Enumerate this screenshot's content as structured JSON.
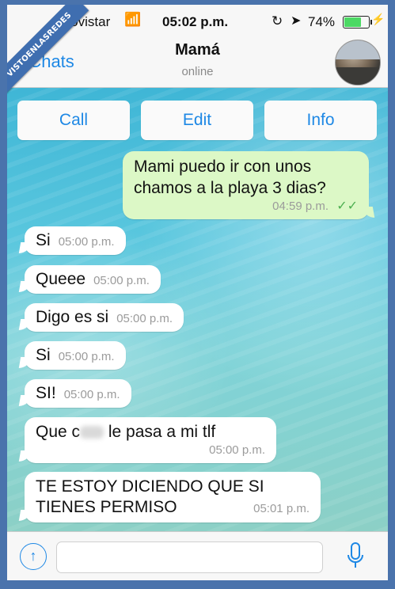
{
  "watermark": "VISTOENLASREDES",
  "status_bar": {
    "carrier": "movistar",
    "time": "05:02 p.m.",
    "battery_pct": "74%",
    "battery_level": 0.74
  },
  "nav": {
    "back_label": "Chats",
    "title": "Mamá",
    "subtitle": "online"
  },
  "actions": {
    "call": "Call",
    "edit": "Edit",
    "info": "Info"
  },
  "messages": [
    {
      "dir": "out",
      "line1": "Mami puedo ir con unos",
      "line2": "chamos a la playa 3 dias?",
      "time": "04:59 p.m."
    },
    {
      "dir": "in",
      "text": "Si",
      "time": "05:00 p.m."
    },
    {
      "dir": "in",
      "text": "Queee",
      "time": "05:00 p.m."
    },
    {
      "dir": "in",
      "text": "Digo es si",
      "time": "05:00 p.m."
    },
    {
      "dir": "in",
      "text": "Si",
      "time": "05:00 p.m."
    },
    {
      "dir": "in",
      "text": "SI!",
      "time": "05:00 p.m."
    },
    {
      "dir": "in",
      "text_a": "Que c",
      "text_b": "le pasa a mi tlf",
      "time": "05:00 p.m."
    },
    {
      "dir": "in",
      "line1": "TE ESTOY DICIENDO QUE SI",
      "line2": "TIENES PERMISO",
      "time": "05:01 p.m."
    }
  ],
  "colors": {
    "accent": "#1e88e5",
    "outgoing_bubble": "#dcf8c6",
    "incoming_bubble": "#ffffff",
    "read_ticks": "#4caf50"
  },
  "icons": [
    "wifi-icon",
    "rotation-lock-icon",
    "location-arrow-icon",
    "battery-icon",
    "charging-bolt-icon",
    "back-chevron-icon",
    "double-check-icon",
    "upload-arrow-icon",
    "microphone-icon"
  ]
}
